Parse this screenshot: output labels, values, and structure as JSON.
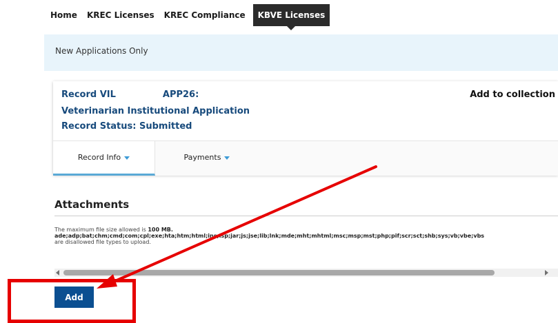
{
  "nav": {
    "tabs": [
      "Home",
      "KREC Licenses",
      "KREC Compliance",
      "KBVE Licenses"
    ],
    "active_index": 3
  },
  "notice": {
    "text": "New Applications Only"
  },
  "record": {
    "line1_part1": "Record VIL",
    "line1_part2": "APP26:",
    "line2": "Veterinarian Institutional Application",
    "line3": "Record Status: Submitted",
    "add_to_collection": "Add to collection",
    "tabs": [
      {
        "label": "Record Info"
      },
      {
        "label": "Payments"
      }
    ]
  },
  "attachments": {
    "title": "Attachments",
    "size_prefix": "The maximum file size allowed is ",
    "size_value": "100 MB.",
    "types": "ade;adp;bat;chm;cmd;com;cpl;exe;hta;htm;html;ins;isp;jar;js;jse;lib;lnk;mde;mht;mhtml;msc;msp;mst;php;pif;scr;sct;shb;sys;vb;vbe;vbs",
    "disallowed_note": "are disallowed file types to upload.",
    "scroll_position": 0.0,
    "add_button_label": "Add"
  },
  "colors": {
    "link_blue": "#174a7c",
    "button_blue": "#0b4f91",
    "annotation_red": "#e60000",
    "notice_bg": "#e8f4fb"
  }
}
